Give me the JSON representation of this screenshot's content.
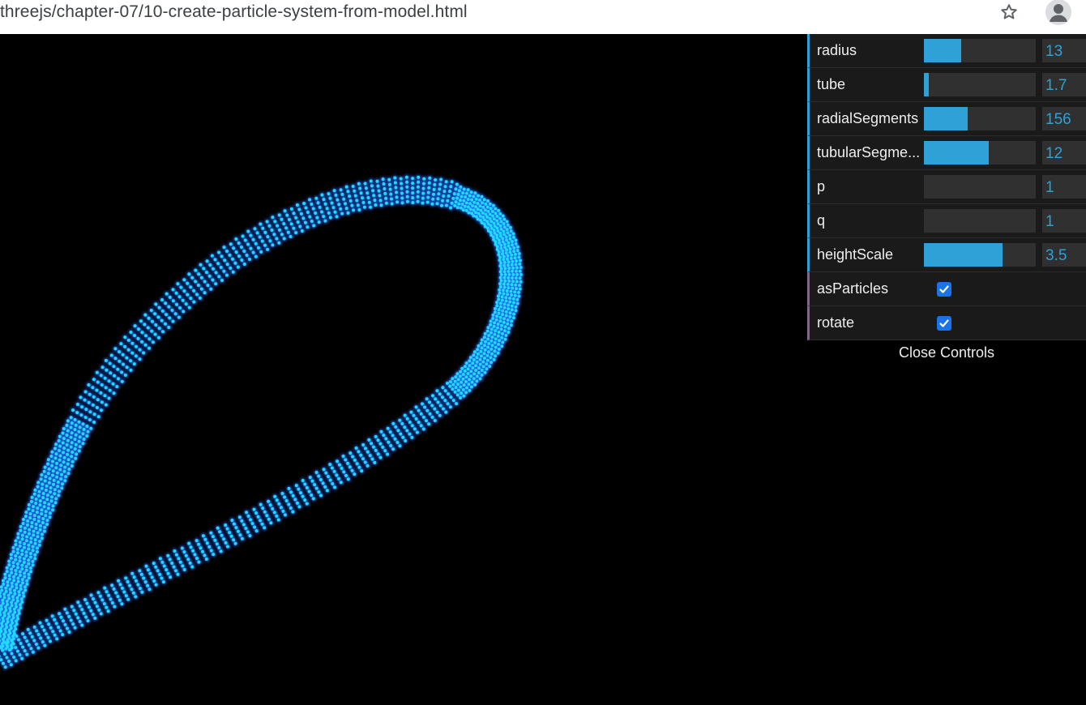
{
  "browser": {
    "url": "threejs/chapter-07/10-create-particle-system-from-model.html",
    "star_icon": "star-icon",
    "profile_icon": "profile-avatar-icon"
  },
  "scene": {
    "description_icon": "torus-knot-particles",
    "particle_color": "#22d8ff",
    "glow_color": "#1f6bff"
  },
  "gui": {
    "controllers": [
      {
        "label": "radius",
        "value": "13",
        "fraction": 0.33
      },
      {
        "label": "tube",
        "value": "1.7",
        "fraction": 0.04
      },
      {
        "label": "radialSegments",
        "value": "156",
        "fraction": 0.39
      },
      {
        "label": "tubularSegme...",
        "value": "12",
        "fraction": 0.58
      },
      {
        "label": "p",
        "value": "1",
        "fraction": 0
      },
      {
        "label": "q",
        "value": "1",
        "fraction": 0
      },
      {
        "label": "heightScale",
        "value": "3.5",
        "fraction": 0.7
      }
    ],
    "toggles": [
      {
        "label": "asParticles",
        "checked": true
      },
      {
        "label": "rotate",
        "checked": true
      }
    ],
    "close_label": "Close Controls",
    "accent": "#2fa1d6"
  }
}
